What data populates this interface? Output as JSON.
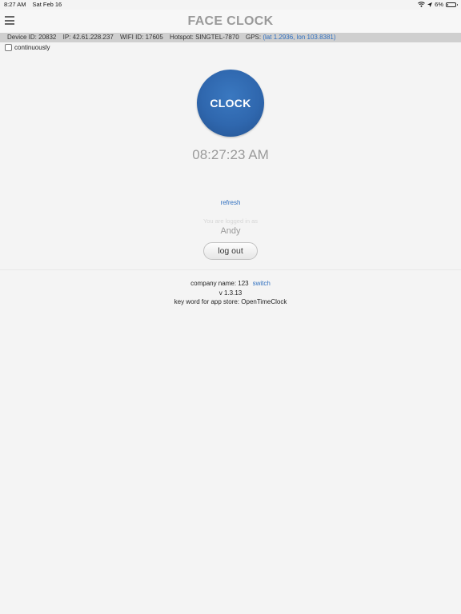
{
  "status_bar": {
    "time": "8:27 AM",
    "date": "Sat Feb 16",
    "battery_percent_text": "6%",
    "battery_level": 0.06,
    "icons": [
      "wifi-icon",
      "location-icon",
      "battery-icon"
    ]
  },
  "header": {
    "title": "FACE CLOCK",
    "menu_icon": "hamburger-menu-icon"
  },
  "info_bar": {
    "device_id": "Device ID: 20832",
    "ip": "IP: 42.61.228.237",
    "wifi_id": "WIFI ID: 17605",
    "hotspot": "Hotspot: SINGTEL-7870",
    "gps_label": "GPS:",
    "gps_value": "(lat 1.2936, lon 103.8381)"
  },
  "continuous": {
    "label": "continuously",
    "checked": false
  },
  "clock": {
    "button_label": "CLOCK",
    "time": "08:27:23 AM",
    "button_color": "#2f67ae"
  },
  "session": {
    "refresh_label": "refresh",
    "logged_in_label": "You are logged in as",
    "user_name": "Andy",
    "logout_label": "log out"
  },
  "footer": {
    "company_label": "company name: 123",
    "switch_label": "switch",
    "version": "v 1.3.13",
    "keyword": "key word for app store: OpenTimeClock"
  },
  "colors": {
    "link": "#2f6fbf",
    "background": "#f4f4f4",
    "info_bar": "#cfcfcf"
  }
}
